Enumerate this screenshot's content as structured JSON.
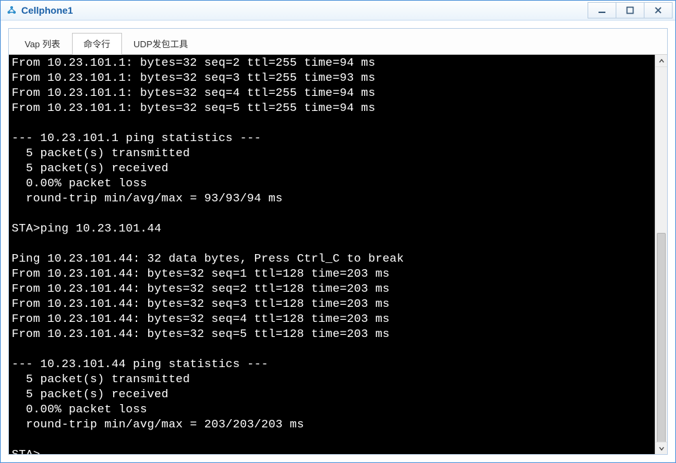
{
  "window": {
    "title": "Cellphone1"
  },
  "tabs": [
    {
      "label": "Vap 列表",
      "active": false
    },
    {
      "label": "命令行",
      "active": true
    },
    {
      "label": "UDP发包工具",
      "active": false
    }
  ],
  "terminal": {
    "lines": [
      "From 10.23.101.1: bytes=32 seq=2 ttl=255 time=94 ms",
      "From 10.23.101.1: bytes=32 seq=3 ttl=255 time=93 ms",
      "From 10.23.101.1: bytes=32 seq=4 ttl=255 time=94 ms",
      "From 10.23.101.1: bytes=32 seq=5 ttl=255 time=94 ms",
      "",
      "--- 10.23.101.1 ping statistics ---",
      "  5 packet(s) transmitted",
      "  5 packet(s) received",
      "  0.00% packet loss",
      "  round-trip min/avg/max = 93/93/94 ms",
      "",
      "STA>ping 10.23.101.44",
      "",
      "Ping 10.23.101.44: 32 data bytes, Press Ctrl_C to break",
      "From 10.23.101.44: bytes=32 seq=1 ttl=128 time=203 ms",
      "From 10.23.101.44: bytes=32 seq=2 ttl=128 time=203 ms",
      "From 10.23.101.44: bytes=32 seq=3 ttl=128 time=203 ms",
      "From 10.23.101.44: bytes=32 seq=4 ttl=128 time=203 ms",
      "From 10.23.101.44: bytes=32 seq=5 ttl=128 time=203 ms",
      "",
      "--- 10.23.101.44 ping statistics ---",
      "  5 packet(s) transmitted",
      "  5 packet(s) received",
      "  0.00% packet loss",
      "  round-trip min/avg/max = 203/203/203 ms",
      "",
      "STA>"
    ]
  }
}
